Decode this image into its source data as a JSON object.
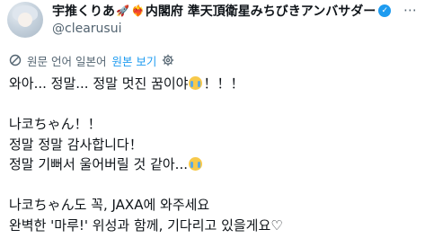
{
  "tweet": {
    "display_name": "宇推くりあ",
    "name_suffix": "内閣府 準天頂衛星みちびきアンバサダー",
    "name_emojis": [
      "rocket-emoji",
      "heart-fire-emoji"
    ],
    "handle": "@clearusui",
    "verified": true,
    "more_icon": "more-icon"
  },
  "translation": {
    "label": "원문 언어 일본어",
    "link": "원본 보기",
    "translate_icon": "translate-icon",
    "settings_icon": "gear-icon"
  },
  "body": {
    "line1_text": "와아... 정말... 정말 멋진 꿈이야",
    "line1_suffix": "！！！",
    "line2": "나코ちゃん！！",
    "line3": "정말 정말 감사합니다！",
    "line4_text": "정말 기뻐서 울어버릴 것 같아...",
    "line5": "나코ちゃん도 꼭, JAXA에 와주세요",
    "line6": "완벽한 '마루!' 위성과 함께, 기다리고 있을게요♡",
    "crying_emoji": "loudly-crying-face-emoji"
  }
}
